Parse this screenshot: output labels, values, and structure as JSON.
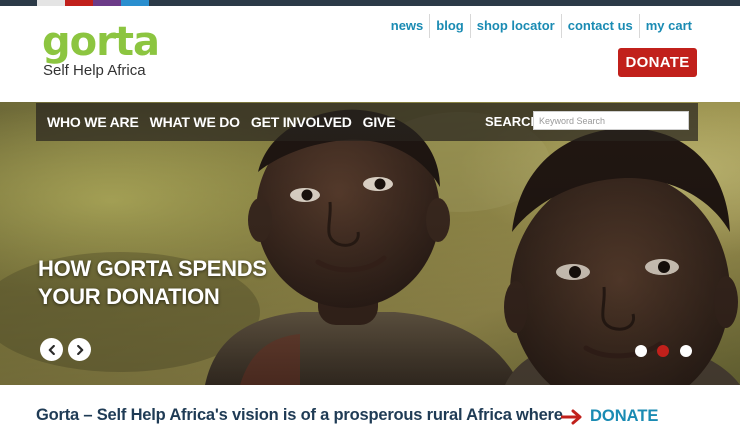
{
  "colors": {
    "brand_green": "#8cc540",
    "brand_red": "#c1201b",
    "nav_link_blue": "#1a8bb3",
    "heading_navy": "#1f3b55",
    "stripe": [
      "#2b3a47",
      "#e4e4e4",
      "#c1201b",
      "#6c3b88",
      "#2a8fcf"
    ]
  },
  "logo": {
    "wordmark": "gorta",
    "tagline": "Self Help Africa"
  },
  "utility_nav": {
    "items": [
      "news",
      "blog",
      "shop locator",
      "contact us",
      "my cart"
    ]
  },
  "header": {
    "donate_label": "DONATE"
  },
  "main_nav": {
    "items": [
      "WHO WE ARE",
      "WHAT WE DO",
      "GET INVOLVED",
      "GIVE"
    ],
    "search_label": "SEARCH",
    "search_placeholder": "Keyword Search",
    "search_value": ""
  },
  "hero": {
    "title": "HOW GORTA SPENDS YOUR DONATION",
    "image": "photo-two-children-smiling",
    "slides_total": 3,
    "active_slide": 2
  },
  "intro": {
    "text": "Gorta – Self Help Africa's vision is of a prosperous rural Africa where",
    "donate_link_label": "DONATE",
    "donate_link_icon": "arrow-right-icon"
  }
}
